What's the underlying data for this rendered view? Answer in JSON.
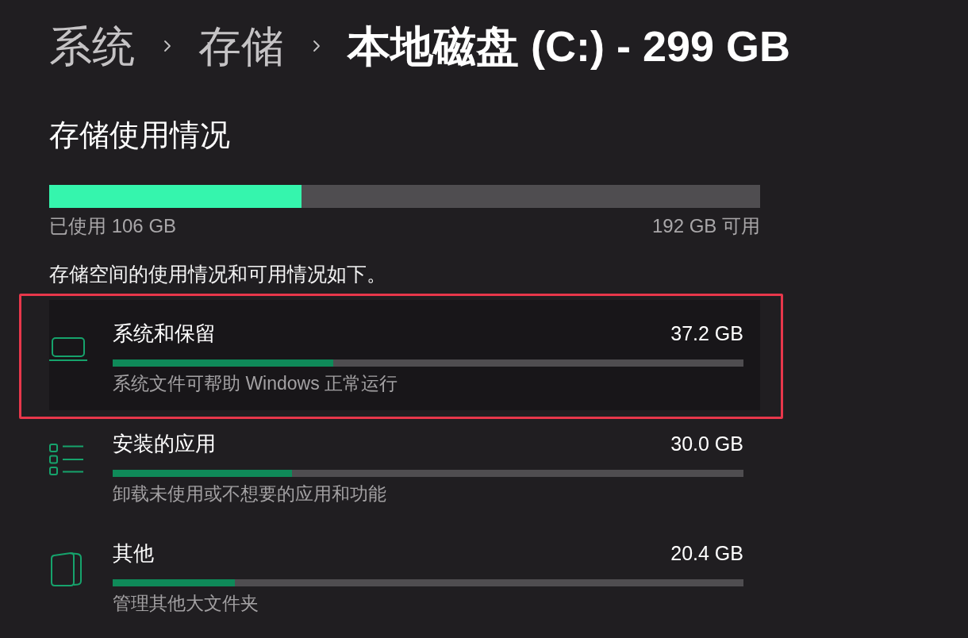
{
  "breadcrumb": [
    {
      "label": "系统",
      "current": false
    },
    {
      "label": "存储",
      "current": false
    },
    {
      "label": "本地磁盘 (C:) - 299 GB",
      "current": true
    }
  ],
  "section_title": "存储使用情况",
  "usage_bar": {
    "level": 0.355,
    "used": "已使用 106 GB",
    "available": "192 GB 可用"
  },
  "description": "存储空间的使用情况和可用情况如下。",
  "categories": [
    {
      "kind": "system",
      "title": "系统和保留",
      "size": "37.2 GB",
      "level": 0.35,
      "description": "系统文件可帮助 Windows 正常运行",
      "selected": true,
      "outlined": true
    },
    {
      "kind": "apps",
      "title": "安装的应用",
      "size": "30.0 GB",
      "level": 0.284,
      "description": "卸载未使用或不想要的应用和功能",
      "selected": false,
      "outlined": false
    },
    {
      "kind": "other",
      "title": "其他",
      "size": "20.4 GB",
      "level": 0.194,
      "description": "管理其他大文件夹",
      "selected": false,
      "outlined": false
    }
  ]
}
